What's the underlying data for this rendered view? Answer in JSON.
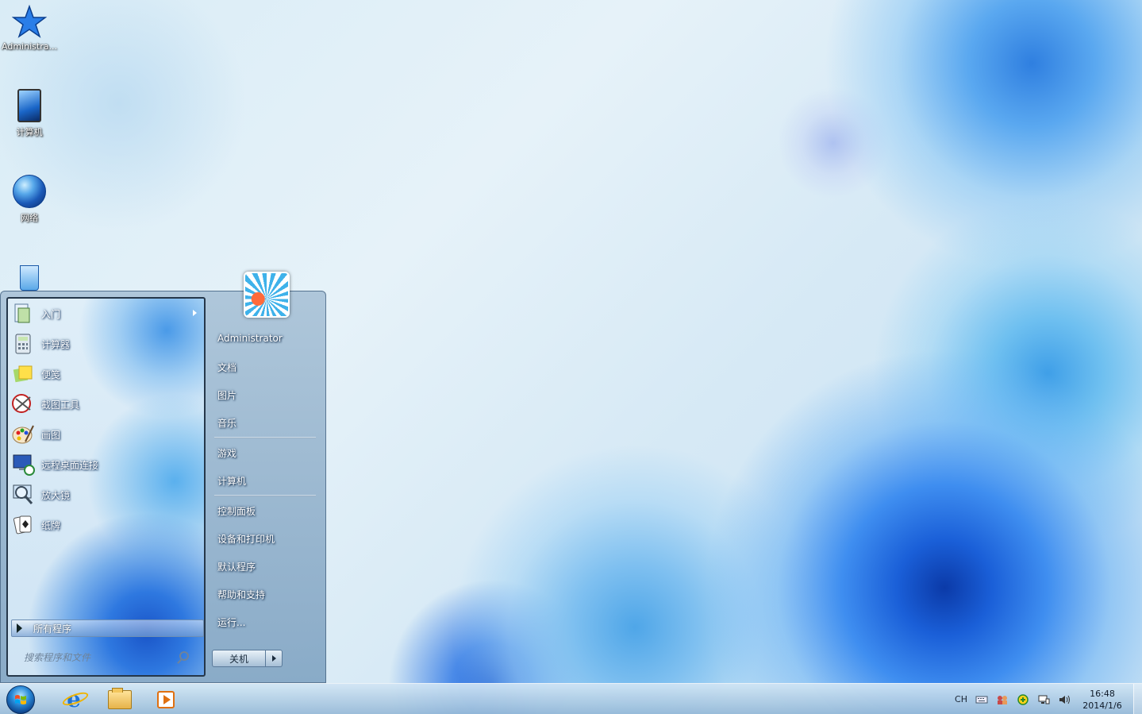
{
  "desktop": {
    "icons": [
      {
        "label": "Administra..."
      },
      {
        "label": "计算机"
      },
      {
        "label": "网络"
      },
      {
        "label": ""
      }
    ]
  },
  "start_menu": {
    "programs": [
      {
        "label": "入门",
        "icon": "getting-started-icon",
        "has_submenu": true
      },
      {
        "label": "计算器",
        "icon": "calculator-icon"
      },
      {
        "label": "便笺",
        "icon": "sticky-notes-icon"
      },
      {
        "label": "截图工具",
        "icon": "snipping-tool-icon"
      },
      {
        "label": "画图",
        "icon": "paint-icon"
      },
      {
        "label": "远程桌面连接",
        "icon": "remote-desktop-icon"
      },
      {
        "label": "放大镜",
        "icon": "magnifier-icon"
      },
      {
        "label": "纸牌",
        "icon": "solitaire-icon"
      }
    ],
    "all_programs": "所有程序",
    "search_placeholder": "搜索程序和文件",
    "right_items": [
      {
        "label": "Administrator"
      },
      {
        "label": "文档"
      },
      {
        "label": "图片"
      },
      {
        "label": "音乐"
      },
      {
        "label": "游戏"
      },
      {
        "label": "计算机"
      },
      {
        "label": "控制面板"
      },
      {
        "label": "设备和打印机"
      },
      {
        "label": "默认程序"
      },
      {
        "label": "帮助和支持"
      },
      {
        "label": "运行..."
      }
    ],
    "shutdown": "关机"
  },
  "taskbar": {
    "pinned": [
      "internet-explorer-icon",
      "windows-explorer-icon",
      "media-player-icon"
    ],
    "tray": {
      "language": "CH",
      "time": "16:48",
      "date": "2014/1/6"
    }
  },
  "colors": {
    "accent": "#1a5fd8",
    "menu_frame": "#8fb0cc"
  }
}
